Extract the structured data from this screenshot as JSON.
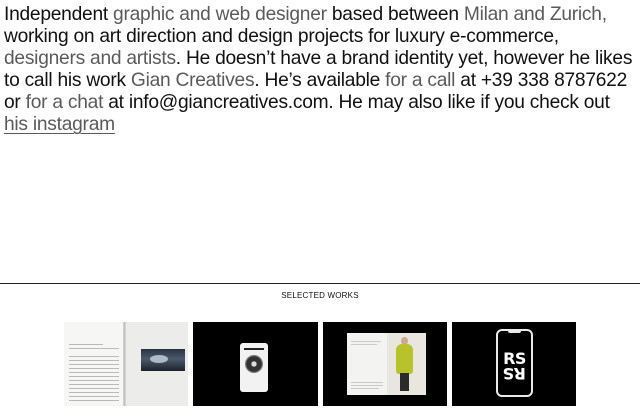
{
  "bio": {
    "segments": [
      {
        "text": "Independent ",
        "style": "dark"
      },
      {
        "text": "graphic and web designer ",
        "style": "light"
      },
      {
        "text": "based between ",
        "style": "dark"
      },
      {
        "text": "Milan and Zurich,",
        "style": "light"
      },
      {
        "text": " working on art direction and design projects for luxury e-commerce, ",
        "style": "dark"
      },
      {
        "text": "designers and artists",
        "style": "light"
      },
      {
        "text": ". He doesn’t have a brand identity yet, however he likes to call his work ",
        "style": "dark"
      },
      {
        "text": "Gian Creatives",
        "style": "light"
      },
      {
        "text": ". He’s available ",
        "style": "dark"
      },
      {
        "text": "for a call",
        "style": "light"
      },
      {
        "text": " at +39 338 8787622 or ",
        "style": "dark"
      },
      {
        "text": "for a chat",
        "style": "light"
      },
      {
        "text": " at info@giancreatives.com. He may also like if you check out ",
        "style": "dark"
      }
    ],
    "instagram_link": "his instagram"
  },
  "works": {
    "title": "SELECTED WORKS"
  },
  "colors": {
    "text_dark": "#111111",
    "text_light": "#5a5a5a",
    "background": "#ffffff"
  }
}
